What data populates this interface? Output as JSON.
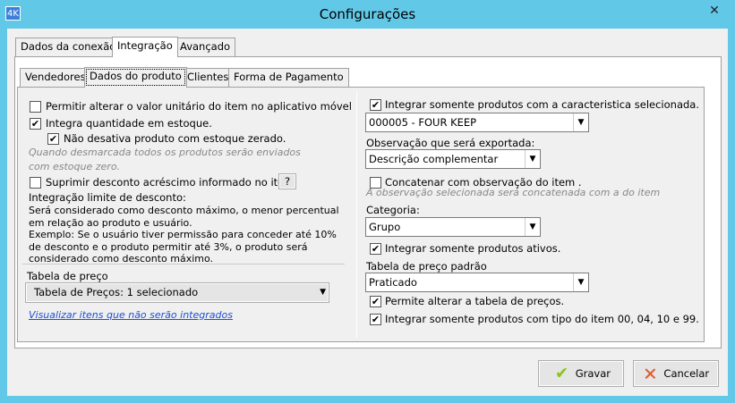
{
  "window": {
    "title": "Configurações",
    "icon": "4K",
    "close": "✕"
  },
  "outer_tabs": [
    "Dados da conexão",
    "Integração",
    "Avançado"
  ],
  "inner_tabs": [
    "Vendedores",
    "Dados do produto",
    "Clientes",
    "Forma de Pagamento"
  ],
  "left": {
    "permitir_alterar": {
      "label": "Permitir alterar o valor unitário do item no aplicativo móvel",
      "checked": false
    },
    "integra_qtd": {
      "label": "Integra quantidade em estoque.",
      "checked": true
    },
    "nao_desativa": {
      "label": "Não desativa produto com estoque zerado.",
      "checked": true
    },
    "hint_estoque": "Quando desmarcada todos os produtos serão enviados com estoque zero.",
    "suprimir": {
      "label": "Suprimir desconto acréscimo informado no item",
      "checked": false
    },
    "help_button": "?",
    "limite_title": "Integração limite de desconto:",
    "limite_text1": "Será considerado como desconto máximo, o menor percentual em relação ao produto e usuário.",
    "limite_text2": "Exemplo: Se o usuário tiver permissão para conceder até 10% de desconto e o produto permitir até 3%, o produto será considerado como desconto máximo.",
    "tabela_label": "Tabela de preço",
    "tabela_value": "Tabela de Preços: 1 selecionado",
    "link": "Visualizar itens que não serão integrados"
  },
  "right": {
    "caracteristica": {
      "label": "Integrar somente produtos com a caracteristica selecionada.",
      "checked": true
    },
    "caracteristica_value": "000005 - FOUR KEEP",
    "obs_label": "Observação que será exportada:",
    "obs_value": "Descrição complementar",
    "concatenar": {
      "label": "Concatenar com observação do item .",
      "checked": false
    },
    "concatenar_hint": "A observação selecionada será concatenada com a do item",
    "categoria_label": "Categoria:",
    "categoria_value": "Grupo",
    "ativos": {
      "label": "Integrar somente produtos ativos.",
      "checked": true
    },
    "tabela_padrao_label": "Tabela de preço padrão",
    "tabela_padrao_value": "Praticado",
    "permite_alterar": {
      "label": "Permite alterar a tabela de preços.",
      "checked": true
    },
    "tipo_item": {
      "label": "Integrar somente produtos com tipo do item 00, 04, 10 e 99.",
      "checked": true
    }
  },
  "buttons": {
    "save": "Gravar",
    "cancel": "Cancelar"
  },
  "check": "✔"
}
